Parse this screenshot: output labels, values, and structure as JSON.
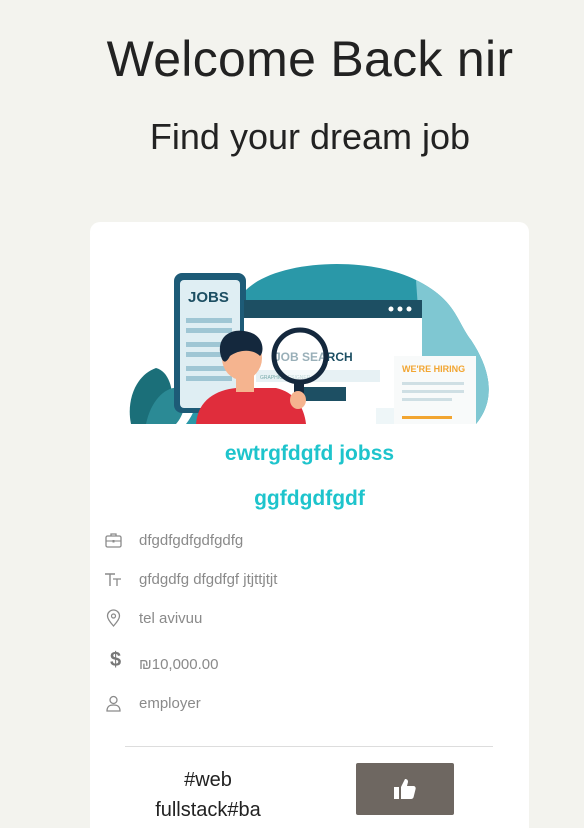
{
  "header": {
    "welcome": "Welcome Back nir",
    "subtitle": "Find your dream job"
  },
  "job_card": {
    "illustration": {
      "jobs_label": "JOBS",
      "search_label": "JOB SEARCH",
      "graphic_label": "GRAPHIC DESIGNER",
      "hiring_label": "WE'RE HIRING"
    },
    "title": "ewtrgfdgfd jobss",
    "company": "ggfdgdfgdf",
    "details": [
      {
        "icon": "briefcase-icon",
        "text": "dfgdfgdfgdfgdfg"
      },
      {
        "icon": "text-size-icon",
        "text": "gfdgdfg dfgdfgf jtjttjtjt"
      },
      {
        "icon": "location-pin-icon",
        "text": "tel avivuu"
      },
      {
        "icon": "dollar-icon",
        "text": "₪10,000.00"
      },
      {
        "icon": "user-icon",
        "text": "employer"
      }
    ],
    "tags_line1": "#web",
    "tags_line2": "fullstack#ba",
    "like_icon": "thumbs-up-icon"
  },
  "colors": {
    "background": "#f3f3ee",
    "accent": "#1ec4cc",
    "button": "#6e6761",
    "muted_text": "#8a8a8a"
  }
}
